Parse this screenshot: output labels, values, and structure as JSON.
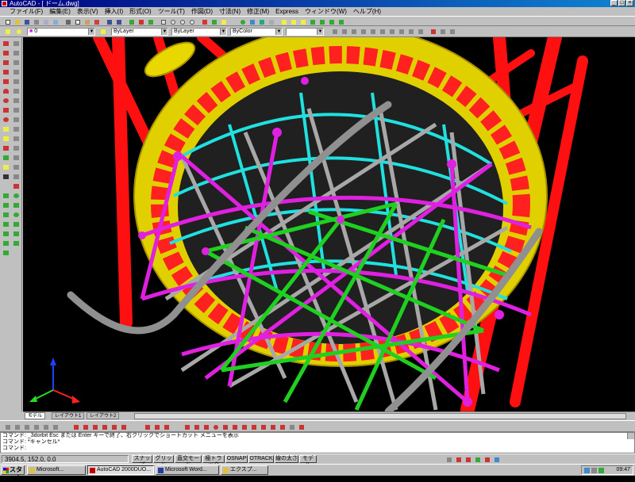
{
  "window": {
    "title": "AutoCAD - [ ドーム.dwg]",
    "close_glyph": "×",
    "min_glyph": "_",
    "max_glyph": "□"
  },
  "menu": [
    "ファイル(F)",
    "編集(E)",
    "表示(V)",
    "挿入(I)",
    "形式(O)",
    "ツール(T)",
    "作図(D)",
    "寸法(N)",
    "修正(M)",
    "Express",
    "ウィンドウ(W)",
    "ヘルプ(H)"
  ],
  "layer_combo": "0",
  "color_combo": "ByLayer",
  "linetype_combo": "ByLayer",
  "lineweight_combo": "ByColor",
  "tabs": {
    "model": "モデル",
    "layout1": "レイアウト1",
    "layout2": "レイアウト2"
  },
  "command_lines": [
    "コマンド: _3dorbit Esc または Enter キーで終了、右クリックでショートカット メニューを表示",
    "コマンド: *キャンセル*",
    "コマンド:"
  ],
  "status": {
    "coords": "3904.5, 152.0, 0.0",
    "buttons": [
      "スナップ",
      "グリッド",
      "直交モード",
      "極トラック",
      "OSNAP",
      "OTRACK",
      "線の太さ",
      "モデル"
    ]
  },
  "taskbar": {
    "start": "スタート",
    "tasks": [
      "Microsoft...",
      "AutoCAD 2000DUO...",
      "Microsoft Word...",
      "エクスプ..."
    ],
    "time": "09:47"
  },
  "colors": {
    "yellow_ring": "#e0d000",
    "red_struts": "#ff1010",
    "magenta": "#e020e0",
    "cyan": "#20e0e0",
    "green": "#20d020",
    "gray": "#a0a0a0"
  }
}
